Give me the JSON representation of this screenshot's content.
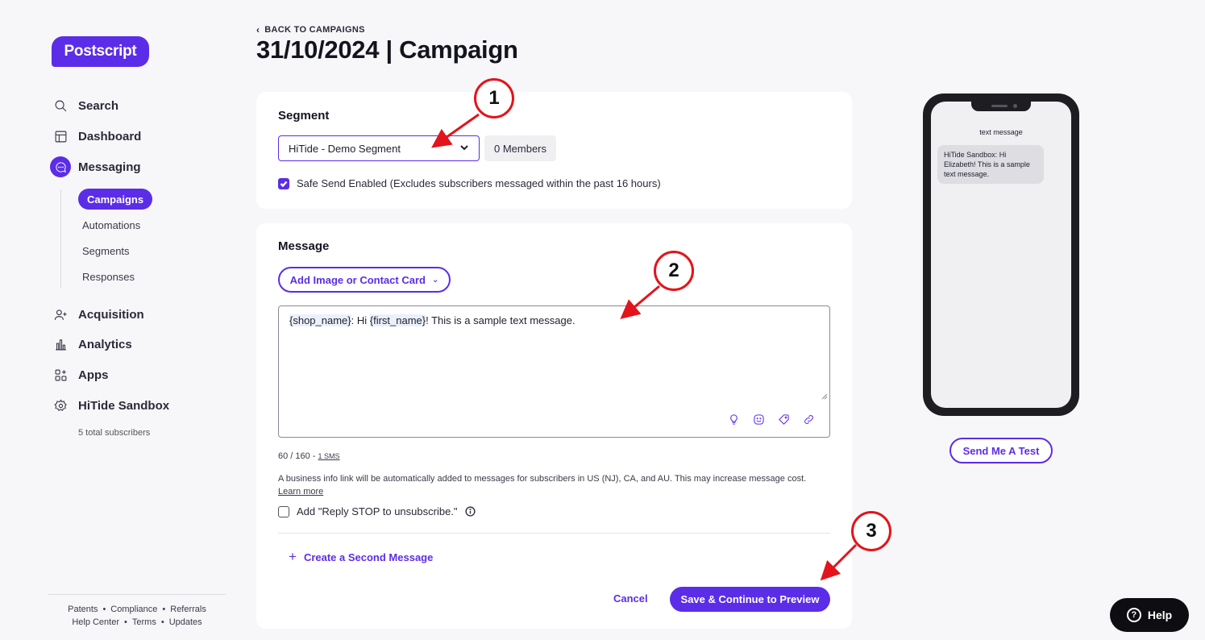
{
  "brand": {
    "logo_text": "Postscript",
    "accent": "#5b2de8"
  },
  "sidebar": {
    "items": [
      {
        "label": "Search",
        "icon": "search-icon"
      },
      {
        "label": "Dashboard",
        "icon": "dashboard-icon"
      },
      {
        "label": "Messaging",
        "icon": "chat-bubble-icon"
      },
      {
        "label": "Acquisition",
        "icon": "user-plus-icon"
      },
      {
        "label": "Analytics",
        "icon": "bar-chart-icon"
      },
      {
        "label": "Apps",
        "icon": "apps-grid-icon"
      },
      {
        "label": "HiTide Sandbox",
        "icon": "gear-icon"
      }
    ],
    "messaging_sub": {
      "active": "Campaigns",
      "items": [
        "Automations",
        "Segments",
        "Responses"
      ]
    },
    "subscribers": "5 total subscribers",
    "footer": {
      "row1": [
        "Patents",
        "Compliance",
        "Referrals"
      ],
      "row2": [
        "Help Center",
        "Terms",
        "Updates"
      ],
      "separator": "•"
    }
  },
  "header": {
    "back_label": "BACK TO CAMPAIGNS",
    "title": "31/10/2024 | Campaign"
  },
  "segment_card": {
    "title": "Segment",
    "selected": "HiTide - Demo Segment",
    "members": "0 Members",
    "safe_send": "Safe Send Enabled (Excludes subscribers messaged within the past 16 hours)",
    "safe_send_checked": true
  },
  "message_card": {
    "title": "Message",
    "add_media_label": "Add Image or Contact Card",
    "body": {
      "var1": "{shop_name}",
      "part1": ": Hi ",
      "var2": "{first_name}",
      "part2": "! This is a sample text message."
    },
    "count": "60 / 160",
    "count_sep": " - ",
    "sms": "1 SMS",
    "info_text": "A business info link will be automatically added to messages for subscribers in US (NJ), CA, and AU. This may increase message cost.",
    "learn_more": "Learn more",
    "reply_stop": "Add \"Reply STOP to unsubscribe.\"",
    "reply_stop_checked": false,
    "second_message": "Create a Second Message",
    "cancel": "Cancel",
    "save": "Save & Continue to Preview"
  },
  "preview": {
    "label": "text message",
    "bubble": "HiTide Sandbox: Hi Elizabeth! This is a sample text message.",
    "test_button": "Send Me A Test"
  },
  "help": {
    "label": "Help",
    "q": "?"
  },
  "annotations": [
    "1",
    "2",
    "3"
  ],
  "annotation_color": "#e3141b"
}
